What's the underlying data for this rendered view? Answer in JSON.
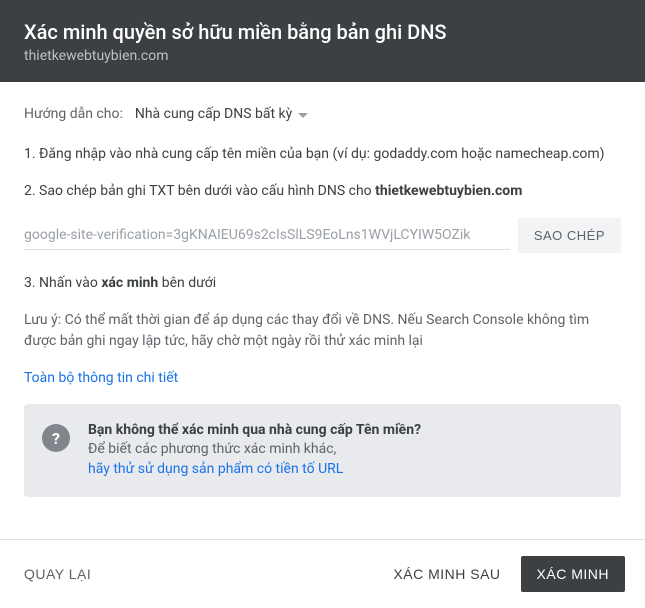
{
  "header": {
    "title": "Xác minh quyền sở hữu miền bằng bản ghi DNS",
    "domain": "thietkewebtuybien.com"
  },
  "instructions": {
    "label": "Hướng dẫn cho:",
    "provider": "Nhà cung cấp DNS bất kỳ"
  },
  "steps": {
    "s1": "1. Đăng nhập vào nhà cung cấp tên miền của bạn (ví dụ: godaddy.com hoặc namecheap.com)",
    "s2_prefix": "2. Sao chép bản ghi TXT bên dưới vào cấu hình DNS cho ",
    "s2_bold": "thietkewebtuybien.com",
    "s3_prefix": "3. Nhấn vào ",
    "s3_bold": "xác minh",
    "s3_suffix": " bên dưới"
  },
  "txt": {
    "record": "google-site-verification=3gKNAIEU69s2cIsSlLS9EoLns1WVjLCYIW5OZik",
    "copy_label": "SAO CHÉP"
  },
  "note": "Lưu ý: Có thể mất thời gian để áp dụng các thay đổi về DNS. Nếu Search Console không tìm được bản ghi ngay lập tức, hãy chờ một ngày rồi thử xác minh lại",
  "details_link": "Toàn bộ thông tin chi tiết",
  "info": {
    "icon": "?",
    "title": "Bạn không thể xác minh qua nhà cung cấp Tên miền?",
    "text": "Để biết các phương thức xác minh khác,",
    "link": "hãy thử sử dụng sản phẩm có tiền tố URL"
  },
  "footer": {
    "back": "QUAY LẠI",
    "later": "XÁC MINH SAU",
    "verify": "XÁC MINH"
  }
}
